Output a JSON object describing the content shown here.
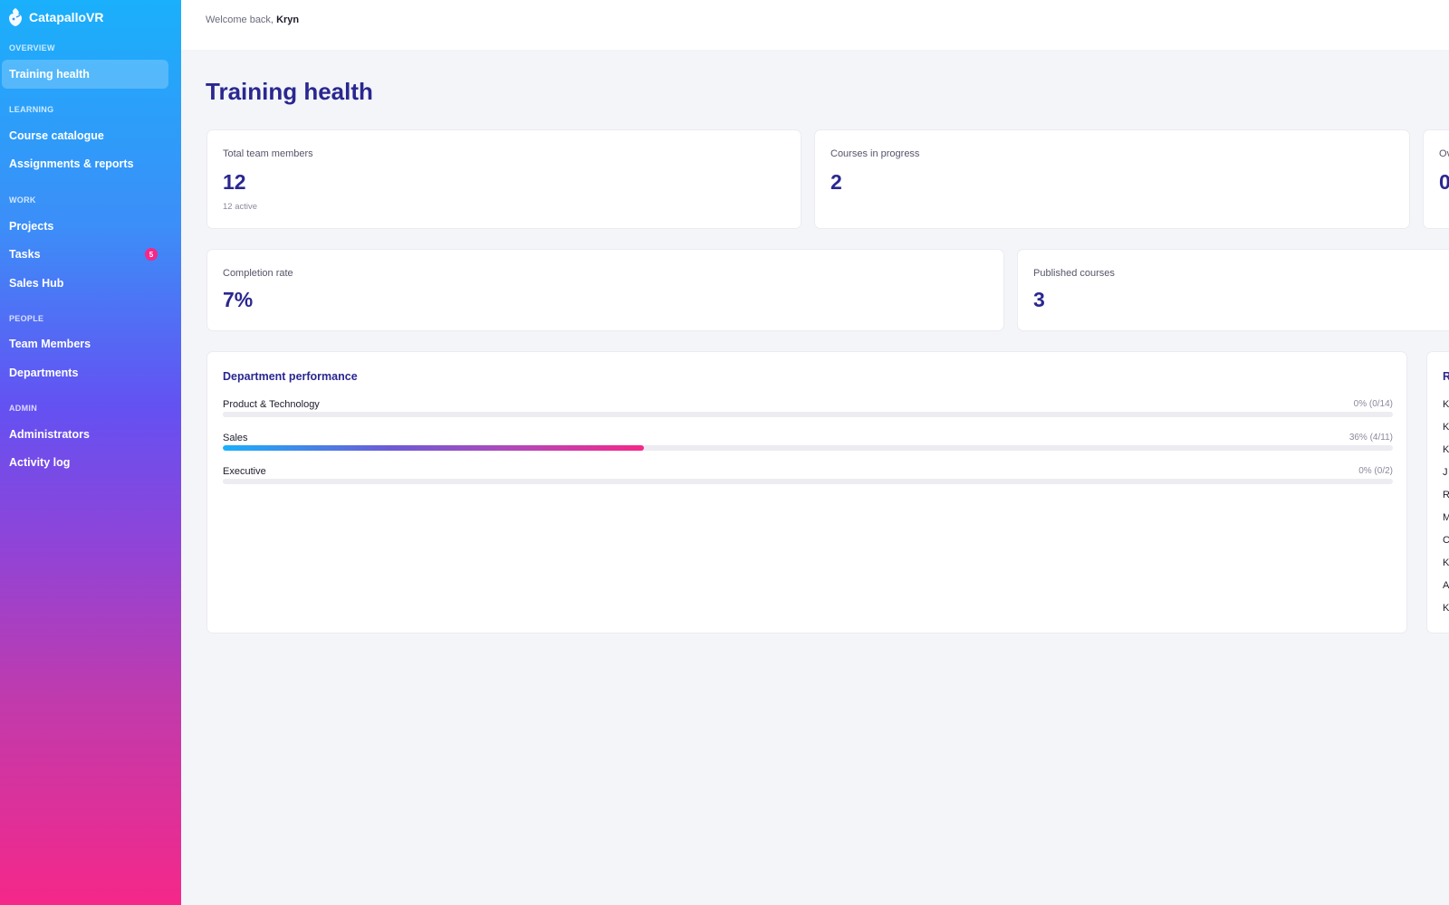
{
  "app": {
    "name": "CatapalloVR"
  },
  "sidebar": {
    "sections": [
      {
        "label": "OVERVIEW"
      },
      {
        "label": "LEARNING"
      },
      {
        "label": "WORK"
      },
      {
        "label": "PEOPLE"
      },
      {
        "label": "ADMIN"
      }
    ],
    "items": [
      {
        "label": "Training health",
        "active": true
      },
      {
        "label": "Course catalogue"
      },
      {
        "label": "Assignments & reports"
      },
      {
        "label": "Projects"
      },
      {
        "label": "Tasks",
        "badge": "5"
      },
      {
        "label": "Sales Hub"
      },
      {
        "label": "Team Members"
      },
      {
        "label": "Departments"
      },
      {
        "label": "Administrators"
      },
      {
        "label": "Activity log"
      }
    ]
  },
  "header": {
    "welcome_prefix": "Welcome back,",
    "user_name": "Kryn"
  },
  "page": {
    "title": "Training health"
  },
  "stats": [
    {
      "label": "Total team members",
      "value": "12",
      "sub": "12 active"
    },
    {
      "label": "Courses in progress",
      "value": "2"
    },
    {
      "label": "Ov",
      "value": "0"
    },
    {
      "label": "Completion rate",
      "value": "7%"
    },
    {
      "label": "Published courses",
      "value": "3"
    }
  ],
  "department_performance": {
    "title": "Department performance",
    "rows": [
      {
        "name": "Product & Technology",
        "meta": "0% (0/14)",
        "percent": 0
      },
      {
        "name": "Sales",
        "meta": "36% (4/11)",
        "percent": 36
      },
      {
        "name": "Executive",
        "meta": "0% (0/2)",
        "percent": 0
      }
    ]
  },
  "right_panel": {
    "title": "R",
    "items": [
      "K",
      "K",
      "K",
      "J",
      "R",
      "M",
      "C",
      "K",
      "A",
      "K"
    ]
  },
  "colors": {
    "accent": "#2a2790",
    "badge": "#f52789",
    "gradient_start": "#1ab0fb",
    "gradient_end": "#f52789"
  }
}
